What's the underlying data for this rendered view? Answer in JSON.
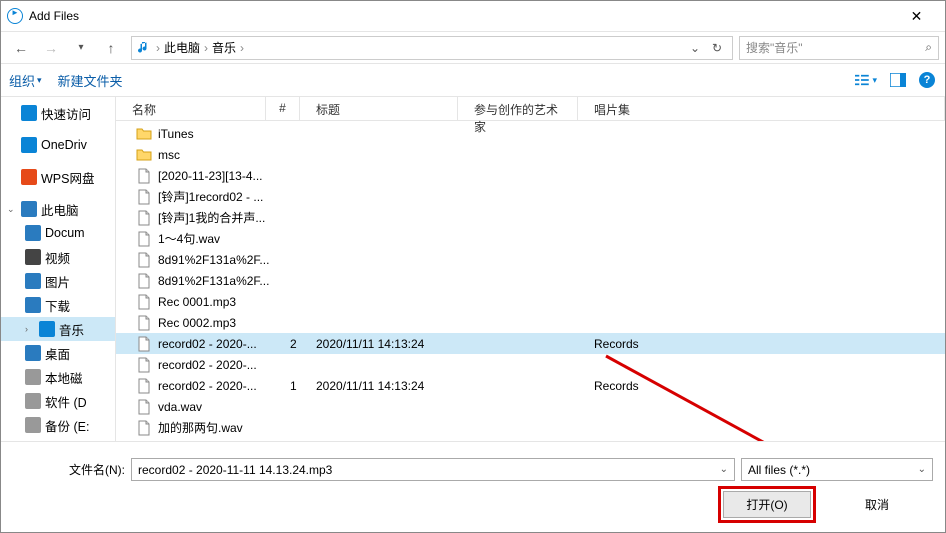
{
  "window": {
    "title": "Add Files",
    "close": "✕"
  },
  "nav": {
    "back": "←",
    "fwd": "→",
    "history_drop": "▾",
    "up": "↑",
    "refresh": "↻",
    "drop": "⌄",
    "crumbs": [
      "此电脑",
      "音乐"
    ],
    "sep": "›",
    "search_placeholder": "搜索\"音乐\"",
    "search_icon": "🔍"
  },
  "toolbar": {
    "organize": "组织",
    "organize_drop": "▾",
    "newfolder": "新建文件夹",
    "view_drop": "▾",
    "help": "?"
  },
  "sidebar": {
    "items": [
      {
        "name": "quick-access",
        "label": "快速访问",
        "icon": "star",
        "color": "#0a84d6",
        "indent": 0,
        "chev": ""
      },
      {
        "name": "onedrive",
        "label": "OneDriv",
        "icon": "cloud",
        "color": "#0a84d6",
        "indent": 0,
        "chev": ""
      },
      {
        "name": "wps",
        "label": "WPS网盘",
        "icon": "wps",
        "color": "#e64a19",
        "indent": 0,
        "chev": ""
      },
      {
        "name": "this-pc",
        "label": "此电脑",
        "icon": "pc",
        "color": "#2a7bbf",
        "indent": 0,
        "chev": "⌄"
      },
      {
        "name": "documents",
        "label": "Docum",
        "icon": "doc",
        "color": "#2a7bbf",
        "indent": 1,
        "chev": ""
      },
      {
        "name": "videos",
        "label": "视频",
        "icon": "vid",
        "color": "#444",
        "indent": 1,
        "chev": ""
      },
      {
        "name": "pictures",
        "label": "图片",
        "icon": "pic",
        "color": "#2a7bbf",
        "indent": 1,
        "chev": ""
      },
      {
        "name": "downloads",
        "label": "下载",
        "icon": "dl",
        "color": "#2a7bbf",
        "indent": 1,
        "chev": ""
      },
      {
        "name": "music",
        "label": "音乐",
        "icon": "music",
        "color": "#0a84d6",
        "indent": 1,
        "chev": "›",
        "selected": true
      },
      {
        "name": "desktop",
        "label": "桌面",
        "icon": "desk",
        "color": "#2a7bbf",
        "indent": 1,
        "chev": ""
      },
      {
        "name": "local-disk",
        "label": "本地磁",
        "icon": "disk",
        "color": "#999",
        "indent": 1,
        "chev": ""
      },
      {
        "name": "software",
        "label": "软件 (D",
        "icon": "disk",
        "color": "#999",
        "indent": 1,
        "chev": ""
      },
      {
        "name": "backup",
        "label": "备份 (E:",
        "icon": "disk",
        "color": "#999",
        "indent": 1,
        "chev": ""
      }
    ]
  },
  "columns": {
    "name": "名称",
    "num": "#",
    "title": "标题",
    "artist": "参与创作的艺术家",
    "album": "唱片集"
  },
  "files": [
    {
      "type": "folder",
      "name": "iTunes"
    },
    {
      "type": "folder",
      "name": "msc"
    },
    {
      "type": "file",
      "name": "[2020-11-23][13-4..."
    },
    {
      "type": "file",
      "name": "[铃声]1record02 - ..."
    },
    {
      "type": "file",
      "name": "[铃声]1我的合并声..."
    },
    {
      "type": "file",
      "name": "1～4句.wav"
    },
    {
      "type": "file",
      "name": "8d91%2F131a%2F..."
    },
    {
      "type": "file",
      "name": "8d91%2F131a%2F..."
    },
    {
      "type": "file",
      "name": "Rec 0001.mp3"
    },
    {
      "type": "file",
      "name": "Rec 0002.mp3"
    },
    {
      "type": "file",
      "name": "record02 - 2020-...",
      "num": "2",
      "title": "2020/11/11 14:13:24",
      "album": "Records",
      "selected": true
    },
    {
      "type": "file",
      "name": "record02 - 2020-..."
    },
    {
      "type": "file",
      "name": "record02 - 2020-...",
      "num": "1",
      "title": "2020/11/11 14:13:24",
      "album": "Records"
    },
    {
      "type": "file",
      "name": "vda.wav"
    },
    {
      "type": "file",
      "name": "加的那两句.wav"
    }
  ],
  "bottom": {
    "filename_label": "文件名(N):",
    "filename_value": "record02 - 2020-11-11 14.13.24.mp3",
    "filter_value": "All files (*.*)",
    "drop": "⌄",
    "open": "打开(O)",
    "cancel": "取消"
  }
}
